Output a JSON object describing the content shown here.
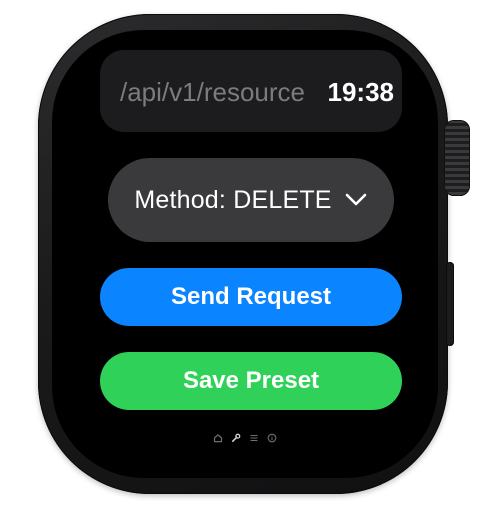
{
  "header": {
    "endpoint_path": "/api/v1/resource",
    "time": "19:38"
  },
  "method_picker": {
    "label": "Method: DELETE"
  },
  "actions": {
    "send_label": "Send Request",
    "save_label": "Save Preset"
  },
  "colors": {
    "send_button": "#0a84ff",
    "save_button": "#30d158",
    "picker_background": "#3a3a3c",
    "header_background": "#1c1c1e"
  },
  "page_indicator": {
    "icons": [
      "home-icon",
      "wrench-icon",
      "list-icon",
      "info-icon"
    ],
    "active_index": 1
  }
}
